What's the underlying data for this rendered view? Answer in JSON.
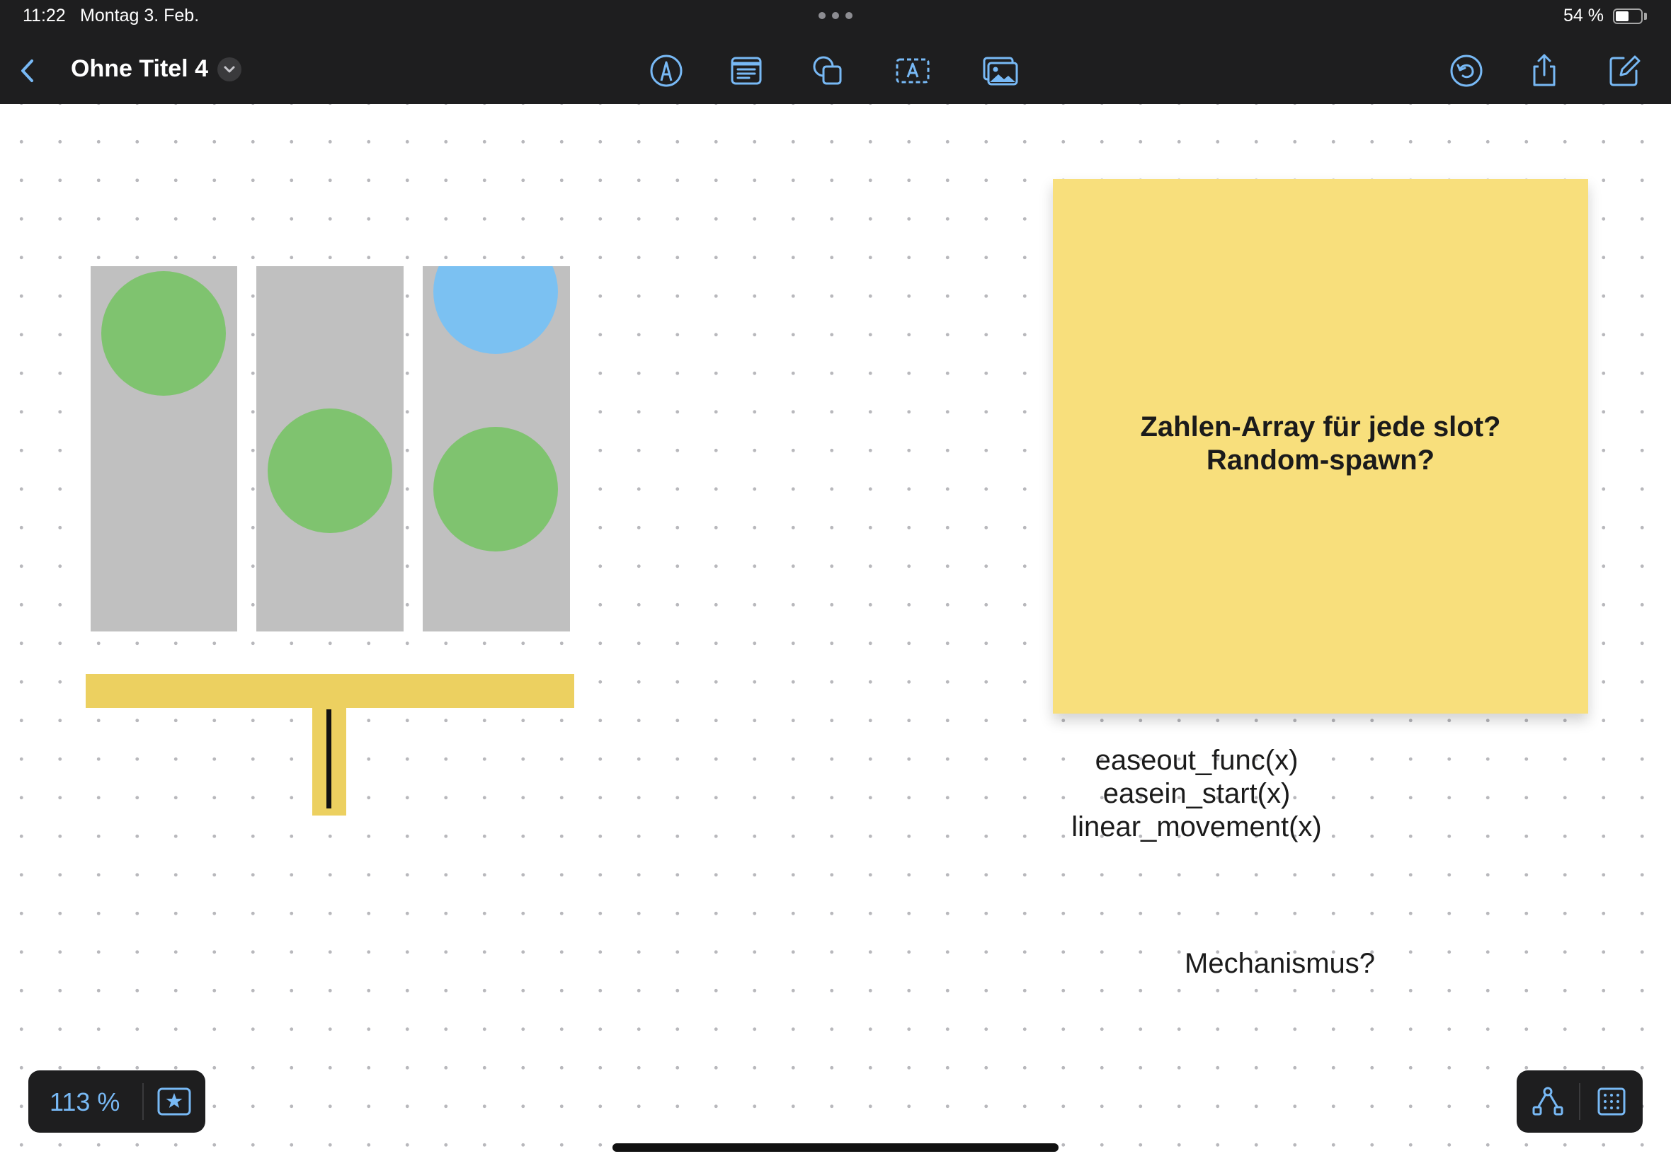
{
  "status_bar": {
    "time": "11:22",
    "date": "Montag 3. Feb.",
    "battery_percent": "54 %",
    "battery_level": 0.54
  },
  "toolbar": {
    "title": "Ohne Titel 4",
    "icons": {
      "back": "chevron-left-icon",
      "title_menu": "chevron-down-icon",
      "pen": "pen-tool-icon",
      "text_box": "text-box-icon",
      "shapes": "shapes-icon",
      "text": "text-tool-icon",
      "media": "photo-icon",
      "undo": "undo-icon",
      "share": "share-icon",
      "new_board": "compose-icon"
    },
    "accent_color": "#78b9f5"
  },
  "canvas": {
    "background": "dotted-grid",
    "sticky_note": {
      "line1": "Zahlen-Array für jede slot?",
      "line2": "Random-spawn?",
      "color": "#f8df7c"
    },
    "function_notes": [
      "easeout_func(x)",
      "easein_start(x)",
      "linear_movement(x)"
    ],
    "mechanism_note": "Mechanismus?",
    "shapes": {
      "lane_color": "#c0c0c0",
      "ball_green": "#7fc36f",
      "ball_blue": "#7bc1f2",
      "bar_color": "#ecd060"
    }
  },
  "zoom": {
    "value": "113 %",
    "favorite_icon": "star-icon"
  },
  "tools": {
    "connector_icon": "connector-icon",
    "grid_icon": "grid-icon"
  }
}
